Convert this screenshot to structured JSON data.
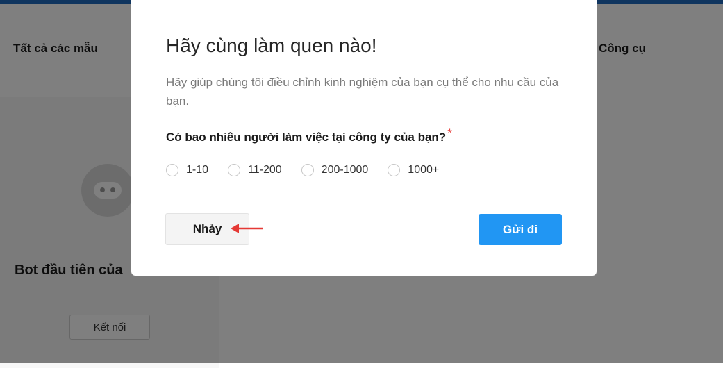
{
  "background": {
    "tab_left": "Tất cả các mẫu",
    "tab_right": "Công cụ",
    "bot_card": {
      "title": "Bot đầu tiên của",
      "connect_label": "Kết nối"
    }
  },
  "modal": {
    "title": "Hãy cùng làm quen nào!",
    "subtitle": "Hãy giúp chúng tôi điều chỉnh kinh nghiệm của bạn cụ thể cho nhu cầu của bạn.",
    "question": "Có bao nhiêu người làm việc tại công ty của bạn?",
    "required_mark": "*",
    "options": [
      "1-10",
      "11-200",
      "200-1000",
      "1000+"
    ],
    "skip_label": "Nhảy",
    "send_label": "Gửi đi"
  },
  "colors": {
    "accent": "#2196f3",
    "required": "#e53935",
    "annotation_arrow": "#e53935",
    "topbar": "#1e6bbf"
  },
  "icons": {
    "bot_avatar": "robot-icon",
    "annotation": "arrow-left-icon"
  }
}
